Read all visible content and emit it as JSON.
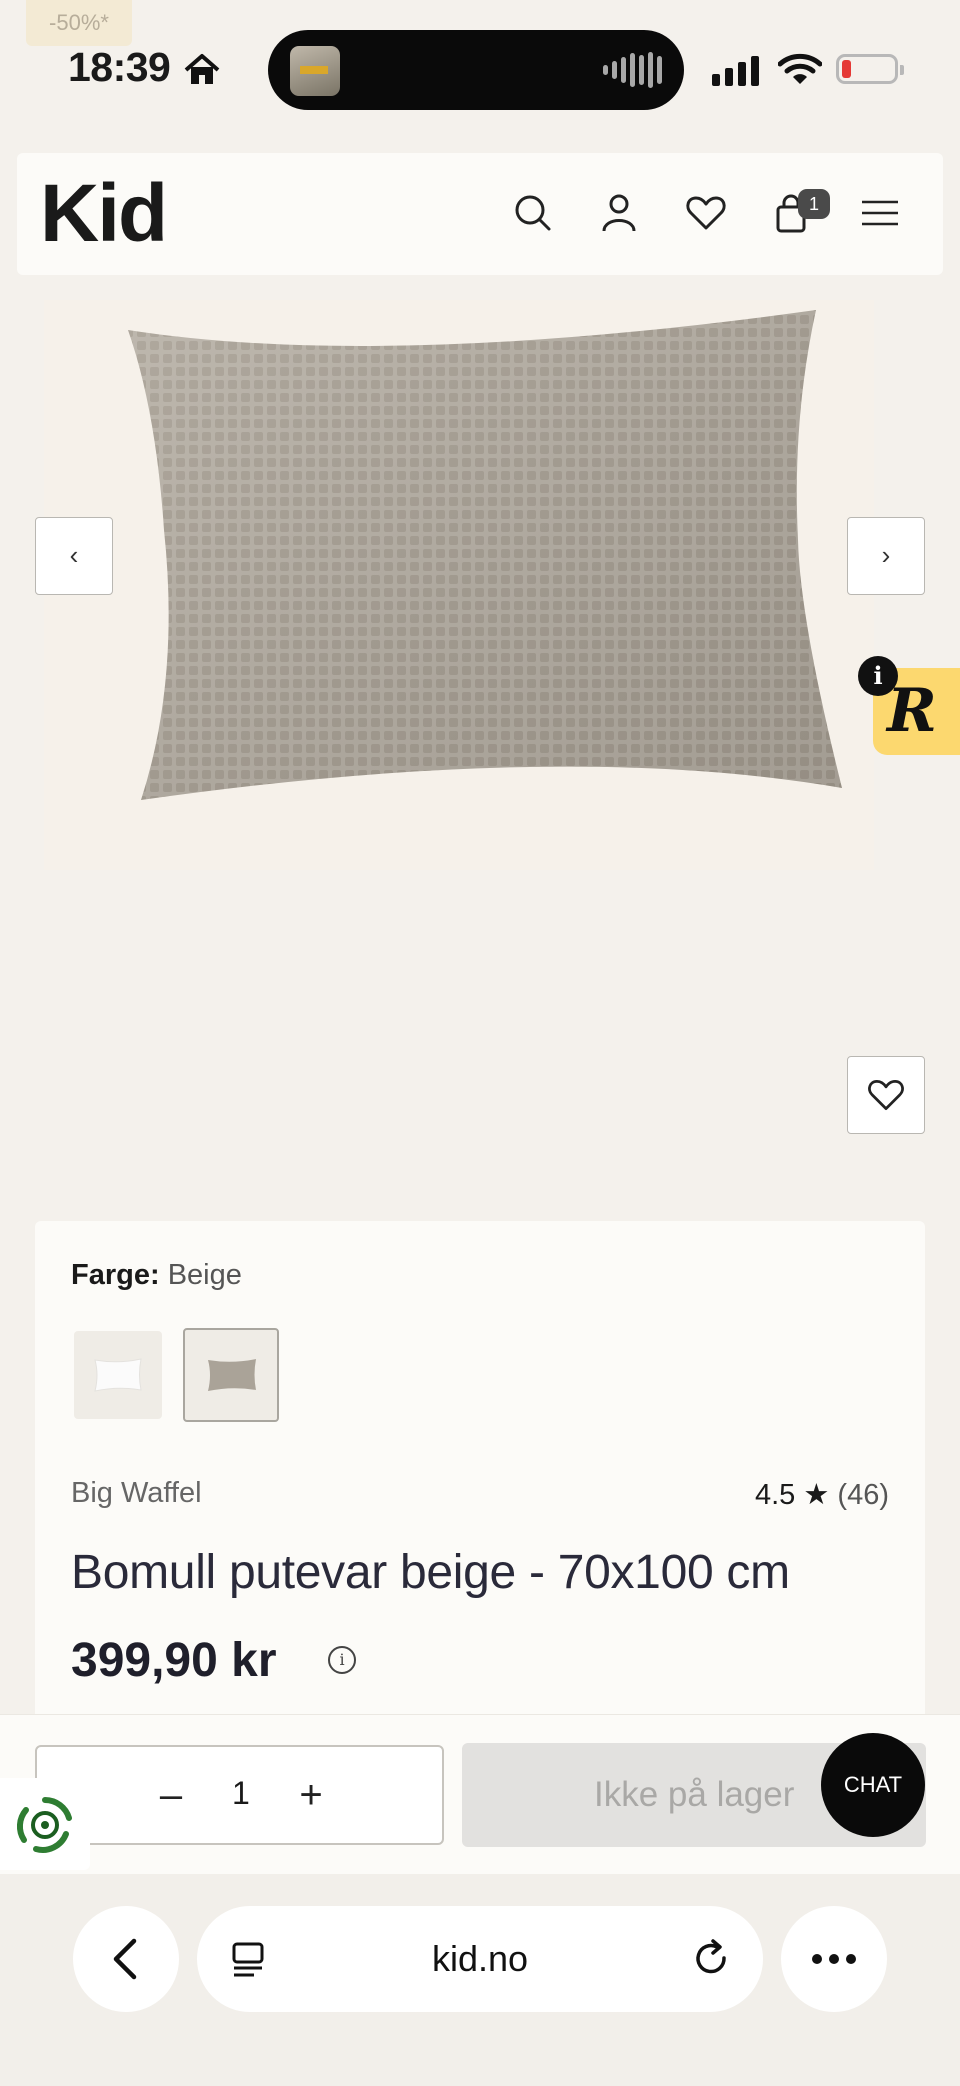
{
  "status": {
    "promo": "-50%*",
    "time": "18:39"
  },
  "header": {
    "logo": "Kid",
    "cart_count": "1",
    "icons": [
      "search-icon",
      "account-icon",
      "wishlist-icon",
      "cart-icon",
      "menu-icon"
    ]
  },
  "gallery": {
    "prev": "‹",
    "next": "›",
    "badge_letter": "R",
    "badge_info": "i"
  },
  "product": {
    "color_label": "Farge:",
    "color_value": "Beige",
    "brand": "Big Waffel",
    "rating": "4.5",
    "rating_star": "★",
    "rating_count": "(46)",
    "title": "Bomull putevar beige - 70x100 cm",
    "price": "399,90 kr",
    "price_info": "i"
  },
  "buy": {
    "minus": "–",
    "quantity": "1",
    "plus": "+",
    "cta": "Ikke på lager",
    "chat": "CHAT"
  },
  "browser": {
    "url": "kid.no"
  },
  "colors": {
    "page_bg": "#f4f1ec",
    "card_bg": "#fcfbf8",
    "badge_yellow": "#fcd86f",
    "disabled_grey": "#e2e1df"
  }
}
